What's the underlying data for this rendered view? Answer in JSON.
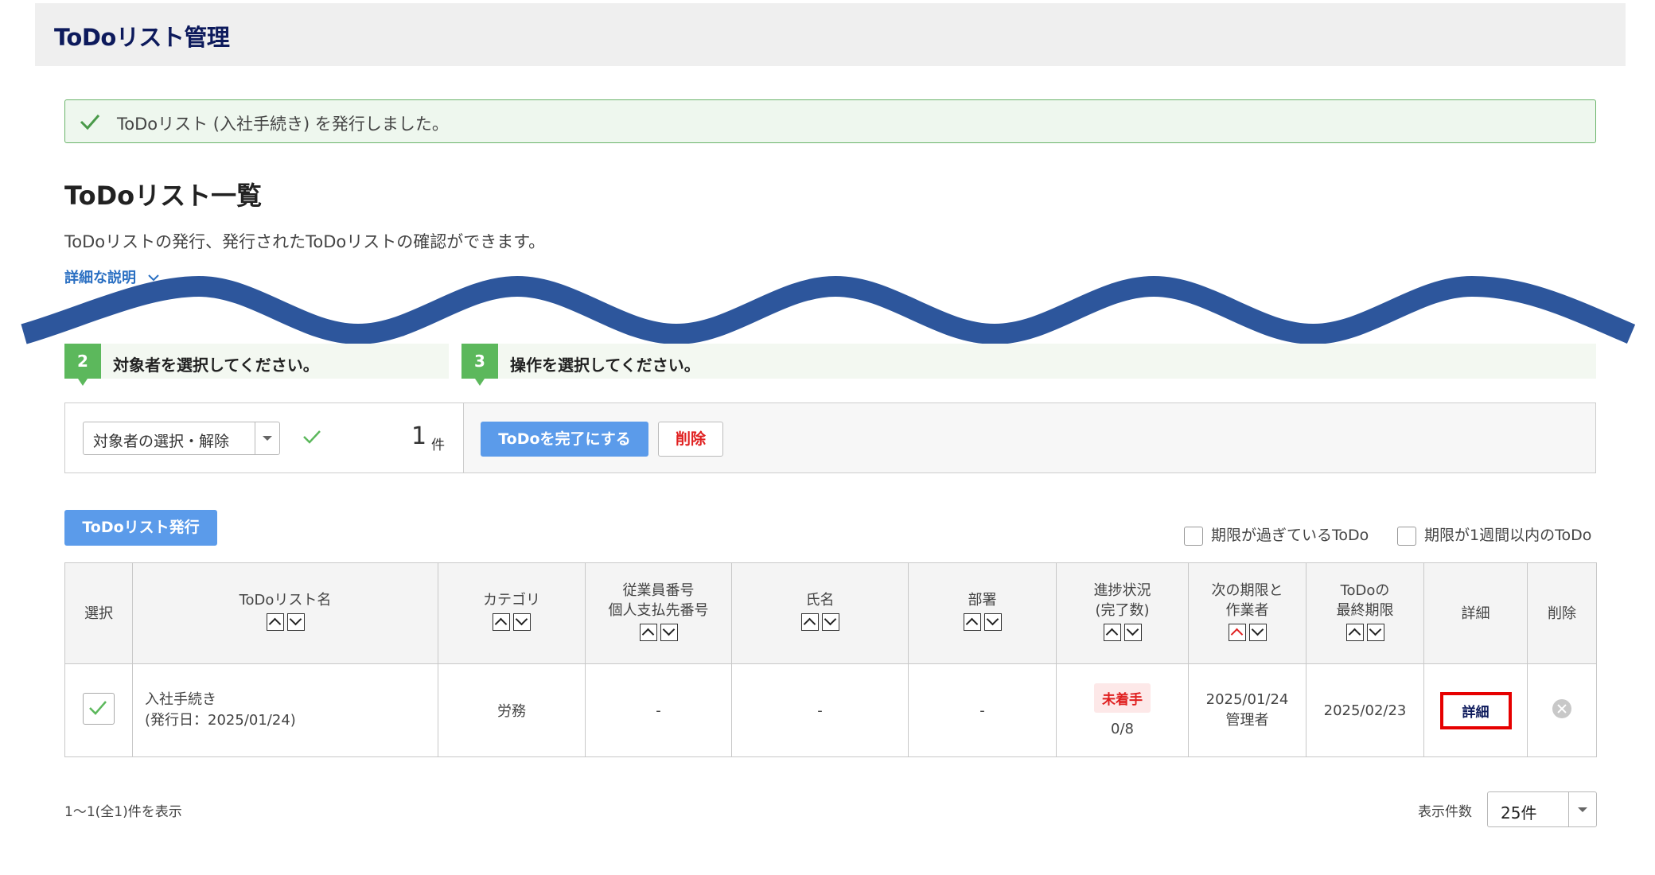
{
  "header": {
    "title": "ToDoリスト管理"
  },
  "alert": {
    "message": "ToDoリスト (入社手続き) を発行しました。"
  },
  "page": {
    "heading": "ToDoリスト一覧",
    "description": "ToDoリストの発行、発行されたToDoリストの確認ができます。",
    "detail_link": "詳細な説明"
  },
  "steps": [
    {
      "num": "2",
      "label": "対象者を選択してください。"
    },
    {
      "num": "3",
      "label": "操作を選択してください。"
    }
  ],
  "ops": {
    "select_label": "対象者の選択・解除",
    "count": "1",
    "unit": "件",
    "complete_button": "ToDoを完了にする",
    "delete_button": "削除"
  },
  "issue_button": "ToDoリスト発行",
  "filters": [
    {
      "label": "期限が過ぎているToDo",
      "checked": false
    },
    {
      "label": "期限が1週間以内のToDo",
      "checked": false
    }
  ],
  "table": {
    "headers": {
      "select": "選択",
      "name": "ToDoリスト名",
      "category": "カテゴリ",
      "emp_no_1": "従業員番号",
      "emp_no_2": "個人支払先番号",
      "person": "氏名",
      "dept": "部署",
      "progress_1": "進捗状況",
      "progress_2": "(完了数)",
      "next_1": "次の期限と",
      "next_2": "作業者",
      "last_1": "ToDoの",
      "last_2": "最終期限",
      "detail": "詳細",
      "delete": "削除"
    },
    "rows": [
      {
        "selected": true,
        "name": "入社手続き",
        "issued": "(発行日：2025/01/24)",
        "category": "労務",
        "emp_no": "-",
        "person": "-",
        "dept": "-",
        "status": "未着手",
        "progress": "0/8",
        "next_date": "2025/01/24",
        "next_worker": "管理者",
        "last_date": "2025/02/23",
        "detail_button": "詳細"
      }
    ]
  },
  "footer": {
    "count_text": "1～1(全1)件を表示",
    "per_page_label": "表示件数",
    "per_page_value": "25件"
  },
  "colors": {
    "header_title": "#0d1a5c",
    "primary_button": "#5b9bea",
    "success": "#5cb85c",
    "danger": "#e02020",
    "wave": "#2d569c"
  }
}
